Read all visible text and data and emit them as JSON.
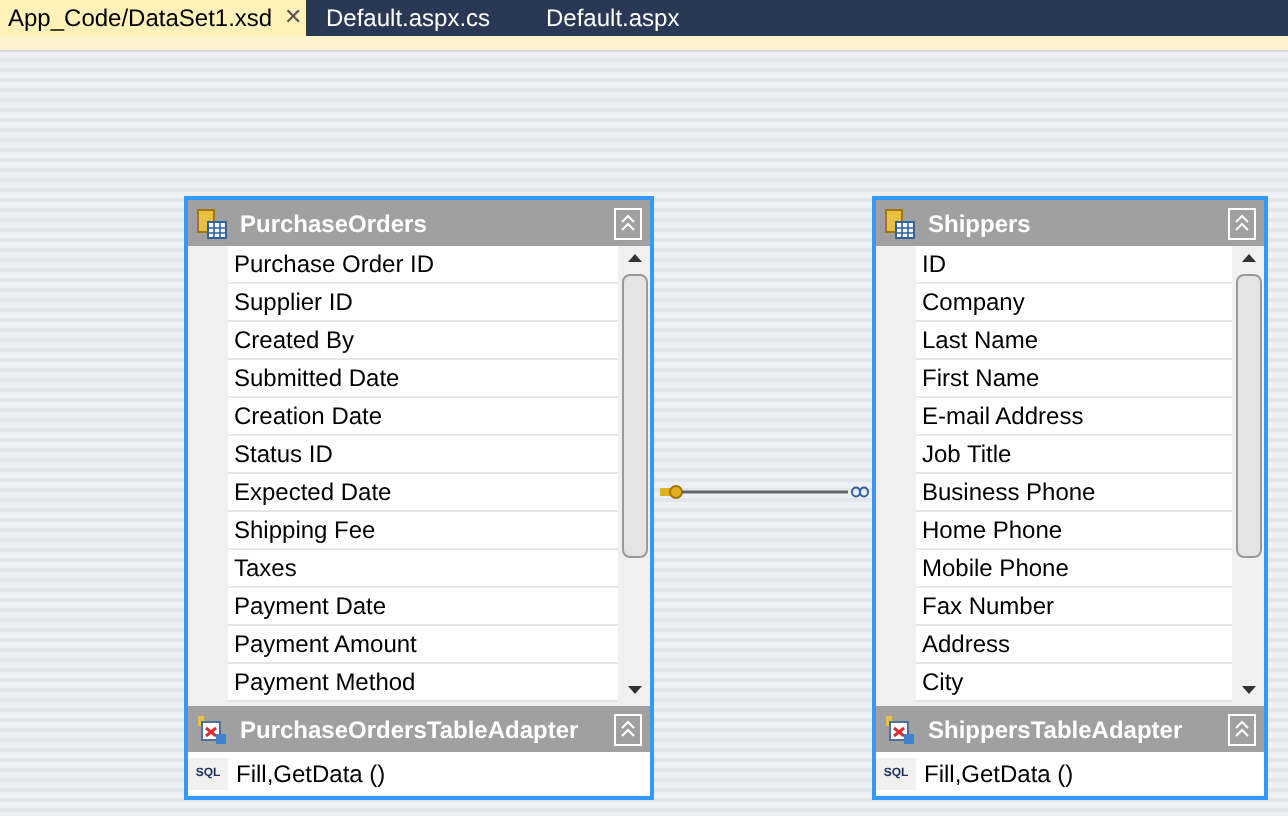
{
  "tabs": [
    {
      "label": "App_Code/DataSet1.xsd",
      "selected": true,
      "close_glyph": "✕"
    },
    {
      "label": "Default.aspx.cs",
      "selected": false
    },
    {
      "label": "Default.aspx",
      "selected": false
    }
  ],
  "tables": [
    {
      "name": "PurchaseOrders",
      "columns": [
        "Purchase Order ID",
        "Supplier ID",
        "Created By",
        "Submitted Date",
        "Creation Date",
        "Status ID",
        "Expected Date",
        "Shipping Fee",
        "Taxes",
        "Payment Date",
        "Payment Amount",
        "Payment Method"
      ],
      "adapter": {
        "name": "PurchaseOrdersTableAdapter",
        "queries": [
          {
            "text": "Fill,GetData ()",
            "icon_label": "SQL"
          }
        ]
      }
    },
    {
      "name": "Shippers",
      "columns": [
        "ID",
        "Company",
        "Last Name",
        "First Name",
        "E-mail Address",
        "Job Title",
        "Business Phone",
        "Home Phone",
        "Mobile Phone",
        "Fax Number",
        "Address",
        "City"
      ],
      "adapter": {
        "name": "ShippersTableAdapter",
        "queries": [
          {
            "text": "Fill,GetData ()",
            "icon_label": "SQL"
          }
        ]
      }
    }
  ]
}
